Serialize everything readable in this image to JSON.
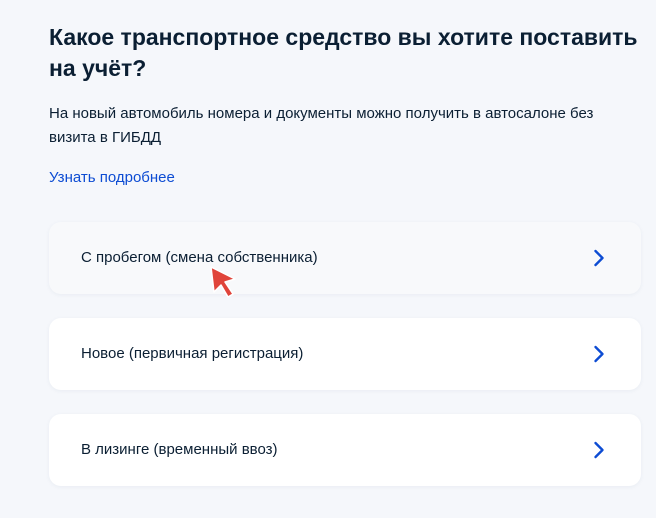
{
  "question": {
    "title": "Какое транспортное средство вы хотите поставить на учёт?",
    "description": "На новый автомобиль номера и документы можно получить в автосалоне без визита в ГИБДД",
    "more_link": "Узнать подробнее"
  },
  "options": [
    {
      "label": "С пробегом (смена собственника)",
      "icon": "chevron-right-icon"
    },
    {
      "label": "Новое (первичная регистрация)",
      "icon": "chevron-right-icon"
    },
    {
      "label": "В лизинге (временный ввоз)",
      "icon": "chevron-right-icon"
    }
  ],
  "colors": {
    "background": "#f5f7fb",
    "text": "#0b1f33",
    "link": "#0d4cd3",
    "chevron": "#0d4cd3",
    "cursor": "#e0443a"
  },
  "cursor": {
    "icon": "mouse-pointer-icon"
  }
}
